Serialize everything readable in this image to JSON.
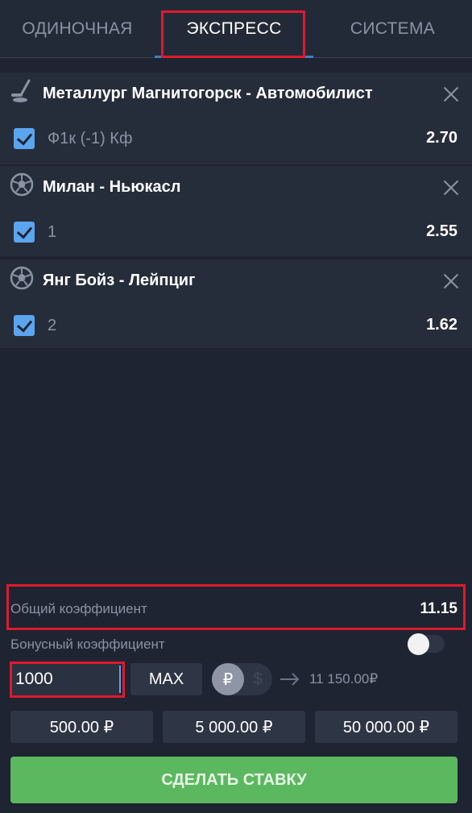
{
  "tabs": [
    {
      "label": "ОДИНОЧНАЯ"
    },
    {
      "label": "ЭКСПРЕСС"
    },
    {
      "label": "СИСТЕМА"
    }
  ],
  "active_tab": "ЭКСПРЕСС",
  "events": [
    {
      "sport_icon": "hockey-icon",
      "title": "Металлург Магнитогорск - Автомобилист",
      "selection": "Ф1к (-1) Кф",
      "odds": "2.70",
      "checked": true
    },
    {
      "sport_icon": "soccer-ball-icon",
      "title": "Милан - Ньюкасл",
      "selection": "1",
      "odds": "2.55",
      "checked": true
    },
    {
      "sport_icon": "soccer-ball-icon",
      "title": "Янг Бойз - Лейпциг",
      "selection": "2",
      "odds": "1.62",
      "checked": true
    }
  ],
  "summary": {
    "total_label": "Общий коэффициент",
    "total_value": "11.15",
    "bonus_label": "Бонусный коэффициент",
    "bonus_enabled": false
  },
  "stake": {
    "value": "1000",
    "max_label": "MAX",
    "currency_active": "₽",
    "currency_inactive": "$",
    "payout": "11 150.00₽"
  },
  "quick_amounts": [
    "500.00 ₽",
    "5 000.00 ₽",
    "50 000.00 ₽"
  ],
  "bet_button": "СДЕЛАТЬ СТАВКУ",
  "colors": {
    "background": "#1e2431",
    "card": "#262d3a",
    "accent_blue": "#5ba4ee",
    "bet_green": "#5cb85f",
    "highlight_red": "#e0192d"
  }
}
